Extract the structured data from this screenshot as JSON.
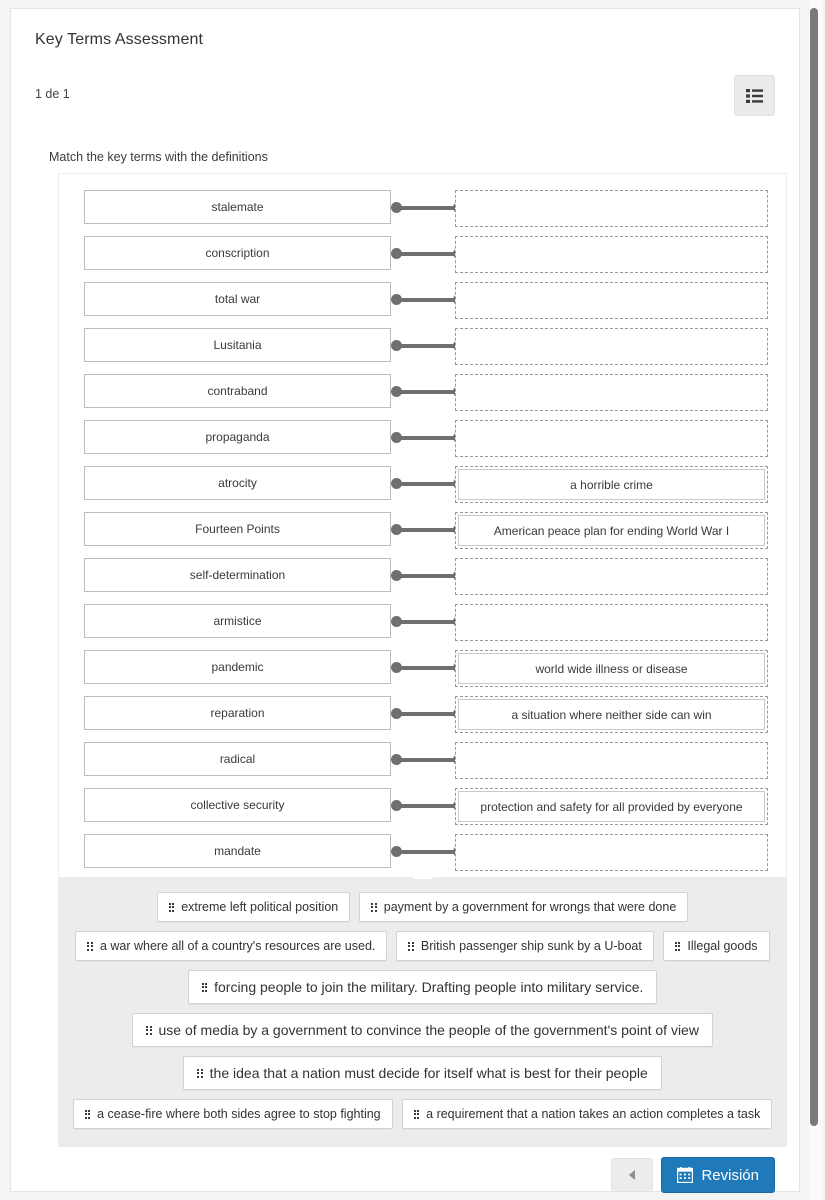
{
  "header": {
    "title": "Key Terms Assessment",
    "counter": "1 de 1",
    "list_button_icon": "list-icon"
  },
  "prompt": "Match the key terms with the definitions",
  "match": {
    "rows": [
      {
        "term": "stalemate",
        "answer": ""
      },
      {
        "term": "conscription",
        "answer": ""
      },
      {
        "term": "total war",
        "answer": ""
      },
      {
        "term": "Lusitania",
        "answer": ""
      },
      {
        "term": "contraband",
        "answer": ""
      },
      {
        "term": "propaganda",
        "answer": ""
      },
      {
        "term": "atrocity",
        "answer": "a horrible crime"
      },
      {
        "term": "Fourteen Points",
        "answer": "American peace plan for ending World War I"
      },
      {
        "term": "self-determination",
        "answer": ""
      },
      {
        "term": "armistice",
        "answer": ""
      },
      {
        "term": "pandemic",
        "answer": "world wide illness or disease"
      },
      {
        "term": "reparation",
        "answer": "a situation where neither side can win"
      },
      {
        "term": "radical",
        "answer": ""
      },
      {
        "term": "collective security",
        "answer": "protection and safety for all provided by everyone"
      },
      {
        "term": "mandate",
        "answer": ""
      }
    ]
  },
  "answer_bank": {
    "lines": [
      {
        "items": [
          {
            "label": "extreme left political position",
            "big": false
          },
          {
            "label": "payment by a government for wrongs that were  done",
            "big": false
          }
        ]
      },
      {
        "items": [
          {
            "label": "a war where all of a country's resources are used.",
            "big": false
          },
          {
            "label": "British passenger ship sunk by a U-boat",
            "big": false
          },
          {
            "label": "Illegal goods",
            "big": false
          }
        ]
      },
      {
        "items": [
          {
            "label": "forcing people to join the military.  Drafting people into military service.",
            "big": true
          }
        ]
      },
      {
        "items": [
          {
            "label": "use of media by a government to convince the people of the government's point of view",
            "big": true
          }
        ]
      },
      {
        "items": [
          {
            "label": "the idea that a nation must decide for itself what is best for their people",
            "big": true
          }
        ]
      },
      {
        "items": [
          {
            "label": "a cease-fire where both sides agree to stop fighting",
            "big": false
          },
          {
            "label": "a requirement that a nation takes an action completes a task",
            "big": false
          }
        ]
      }
    ]
  },
  "footer": {
    "prev_label": "",
    "review_label": "Revisión",
    "review_icon": "calendar-icon"
  },
  "colors": {
    "accent_blue": "#2079b8",
    "bank_background": "#ececec",
    "connector_gray": "#6f6f6f",
    "page_background": "#f4f4f4"
  }
}
